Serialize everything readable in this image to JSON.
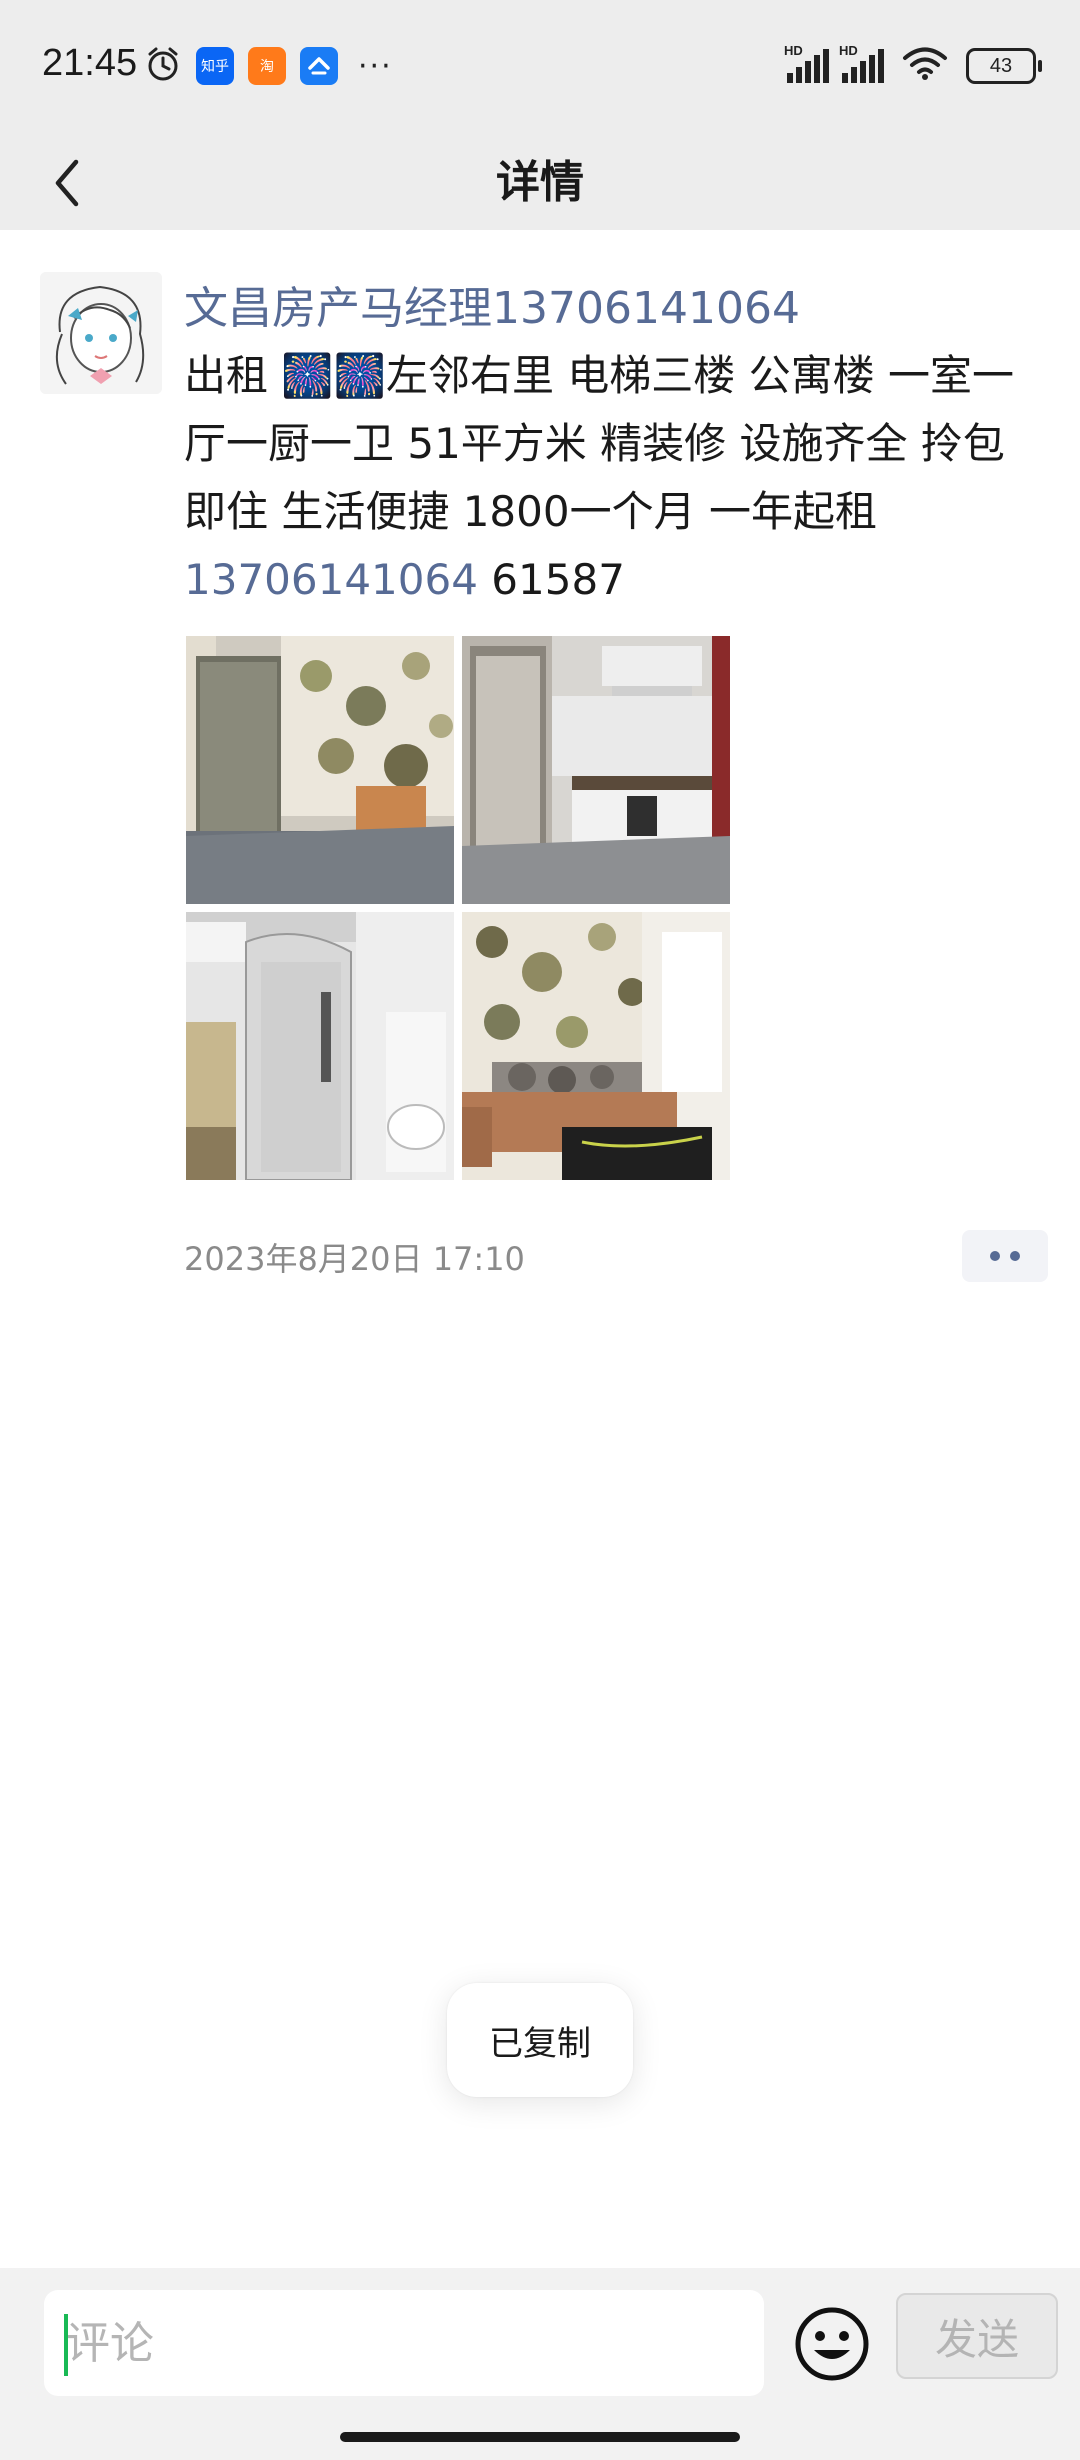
{
  "status_bar": {
    "time": "21:45",
    "app_icons": [
      {
        "icon": "alarm-icon"
      },
      {
        "icon": "zhihu-app-icon",
        "label": "知乎"
      },
      {
        "icon": "taobao-app-icon",
        "label": "淘"
      },
      {
        "icon": "alipay-app-icon"
      }
    ],
    "more": "···",
    "signal_1_label": "HD",
    "signal_2_label": "HD",
    "battery": "43"
  },
  "nav": {
    "title": "详情",
    "back_icon": "chevron-left-icon"
  },
  "post": {
    "author": "文昌房产马经理13706141064",
    "text_before_phone": "出租 🎆🎆左邻右里  电梯三楼 公寓楼  一室一厅一厨一卫  51平方米  精装修  设施齐全 拎包即住 生活便捷 1800一个月  一年起租",
    "phone": "13706141064",
    "text_after_phone": "  61587",
    "images": [
      {
        "description": "bedroom-photo"
      },
      {
        "description": "kitchen-photo"
      },
      {
        "description": "bathroom-photo"
      },
      {
        "description": "living-room-photo"
      }
    ],
    "timestamp": "2023年8月20日 17:10"
  },
  "toast": {
    "text": "已复制"
  },
  "comment_bar": {
    "placeholder": "评论",
    "send_label": "发送"
  },
  "colors": {
    "link": "#576b95",
    "header_bg": "#ededed",
    "caret": "#19b955"
  }
}
